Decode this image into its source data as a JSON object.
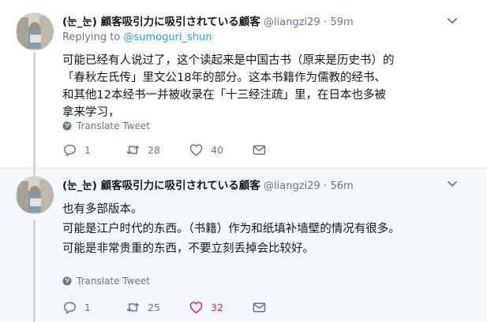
{
  "tweets": [
    {
      "display_name": "(눈_눈) 顧客吸引力に吸引されている顧客",
      "handle": "@liangzi29",
      "separator": "·",
      "time": "59m",
      "reply_prefix": "Replying to ",
      "reply_mention": "@sumoguri_shun",
      "lines": [
        "可能已经有人说过了，这个读起来是中国古书（原来是历史书）的",
        "「春秋左氏传」里文公18年的部分。这本书籍作为儒教的经书、",
        "和其他12本经书一并被收录在「十三经注疏」里，在日本也多被",
        "拿来学习，"
      ],
      "translate_label": "Translate Tweet",
      "actions": {
        "reply_count": "1",
        "retweet_count": "28",
        "like_count": "40"
      },
      "liked": false
    },
    {
      "display_name": "(눈_눈) 顧客吸引力に吸引されている顧客",
      "handle": "@liangzi29",
      "separator": "·",
      "time": "56m",
      "lines": [
        "也有多部版本。",
        "可能是江户时代的东西。（书籍）作为和纸填补墙壁的情况有很多。",
        "可能是非常贵重的东西，不要立刻丢掉会比较好。"
      ],
      "translate_label": "Translate Tweet",
      "actions": {
        "reply_count": "1",
        "retweet_count": "25",
        "like_count": "32"
      },
      "liked": true
    }
  ],
  "colors": {
    "text_primary": "#14171a",
    "text_secondary": "#657786",
    "link": "#1da1f2",
    "like_active": "#e0245e",
    "thread_line": "#cdd6dd",
    "highlight_bg": "#f5f8fa"
  },
  "icons": {
    "caret": "chevron-down-icon",
    "globe": "globe-icon",
    "reply": "reply-icon",
    "retweet": "retweet-icon",
    "like": "heart-icon",
    "dm": "envelope-icon"
  }
}
